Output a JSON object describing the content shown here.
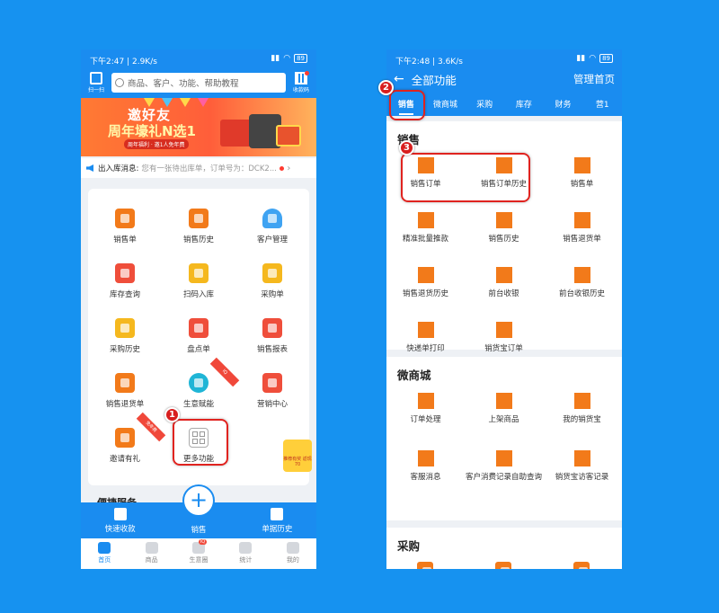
{
  "left": {
    "status": {
      "time": "下午2:47",
      "speed": "2.9K/s",
      "battery": "89"
    },
    "scan_label": "扫一扫",
    "search_placeholder": "商品、客户、功能、帮助教程",
    "qr_label": "收款码",
    "banner": {
      "title1": "邀好友",
      "title2": "周年壕礼N选1",
      "sub": "周年福利 · 邀1人免年费"
    },
    "notice": {
      "label": "出入库消息:",
      "message": "您有一张待出库单，订单号为：DCK2..."
    },
    "grid": [
      {
        "label": "销售单",
        "icon": "sales-order-icon",
        "color": "orange"
      },
      {
        "label": "销售历史",
        "icon": "sales-history-icon",
        "color": "orange"
      },
      {
        "label": "客户管理",
        "icon": "customer-icon",
        "color": "blue"
      },
      {
        "label": "库存查询",
        "icon": "stock-query-icon",
        "color": "red"
      },
      {
        "label": "扫码入库",
        "icon": "scan-in-icon",
        "color": "yellow"
      },
      {
        "label": "采购单",
        "icon": "purchase-order-icon",
        "color": "yellow"
      },
      {
        "label": "采购历史",
        "icon": "purchase-history-icon",
        "color": "yellow"
      },
      {
        "label": "盘点单",
        "icon": "inventory-check-icon",
        "color": "red"
      },
      {
        "label": "销售报表",
        "icon": "sales-report-icon",
        "color": "red"
      },
      {
        "label": "销售退货单",
        "icon": "sales-return-icon",
        "color": "orange"
      },
      {
        "label": "生意赋能",
        "icon": "business-empower-icon",
        "color": "teal",
        "ribbon": "IQ"
      },
      {
        "label": "营销中心",
        "icon": "marketing-icon",
        "color": "red"
      },
      {
        "label": "邀请有礼",
        "icon": "invite-gift-icon",
        "color": "orange",
        "ribbon": "免年费"
      },
      {
        "label": "更多功能",
        "icon": "more-functions-icon",
        "color": "outline"
      }
    ],
    "section_title": "便捷服务",
    "actions": {
      "quick_pay": "快速收款",
      "sales": "销售",
      "doc_history": "单据历史"
    },
    "tabs": [
      "首页",
      "商品",
      "生意圈",
      "统计",
      "我的"
    ],
    "tab_badge": "IQ",
    "promo": "推荐有奖 返现70"
  },
  "right": {
    "status": {
      "time": "下午2:48",
      "speed": "3.6K/s",
      "battery": "89"
    },
    "title": "全部功能",
    "manage": "管理首页",
    "tabs": [
      "销售",
      "微商城",
      "采购",
      "库存",
      "财务",
      "营1"
    ],
    "sections": [
      {
        "title": "销售",
        "items": [
          "销售订单",
          "销售订单历史",
          "销售单",
          "精准批量推款",
          "销售历史",
          "销售退货单",
          "销售退货历史",
          "前台收银",
          "前台收银历史",
          "快递单打印",
          "销货宝订单"
        ]
      },
      {
        "title": "微商城",
        "items": [
          "订单处理",
          "上架商品",
          "我的销货宝",
          "客服消息",
          "客户消费记录自助查询",
          "销货宝访客记录"
        ]
      },
      {
        "title": "采购",
        "items": []
      }
    ]
  },
  "callouts": [
    "1",
    "2",
    "3"
  ],
  "colors": {
    "accent": "#1a8cf0",
    "background": "#1692f0",
    "icon_orange": "#f27a1a",
    "highlight": "#e0231f"
  }
}
